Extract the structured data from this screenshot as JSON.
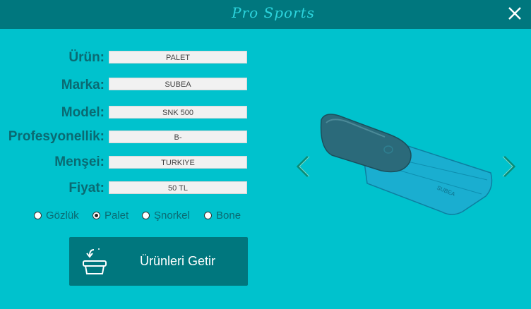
{
  "window": {
    "title": "Pro Sports"
  },
  "form": {
    "urun": {
      "label": "Ürün:",
      "value": "PALET"
    },
    "marka": {
      "label": "Marka:",
      "value": "SUBEA"
    },
    "model": {
      "label": "Model:",
      "value": "SNK 500"
    },
    "profesyonellik": {
      "label": "Profesyonellik:",
      "value": "B-"
    },
    "mensei": {
      "label": "Menşei:",
      "value": "TURKIYE"
    },
    "fiyat": {
      "label": "Fiyat:",
      "value": "50 TL"
    }
  },
  "categories": [
    {
      "label": "Gözlük",
      "selected": false
    },
    {
      "label": "Palet",
      "selected": true
    },
    {
      "label": "Şnorkel",
      "selected": false
    },
    {
      "label": "Bone",
      "selected": false
    }
  ],
  "action": {
    "label": "Ürünleri Getir",
    "icon": "basket-icon"
  },
  "product_image": {
    "brand_text": "SUBEA"
  },
  "colors": {
    "background": "#00c2cd",
    "titlebar": "#00777e",
    "label": "#0a6a72"
  }
}
